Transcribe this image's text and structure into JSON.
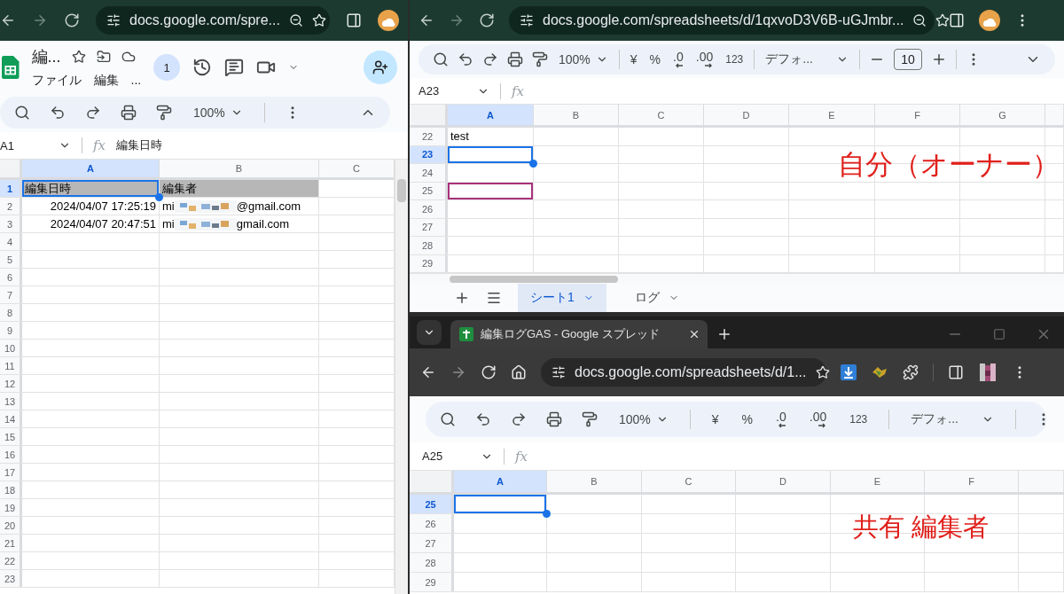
{
  "left_window": {
    "address_bar": {
      "url": "docs.google.com/spre..."
    },
    "document": {
      "title": "編...",
      "menus": [
        "ファイル",
        "編集",
        "..."
      ],
      "viewer_count": "1"
    },
    "toolbar": {
      "zoom": "100%"
    },
    "formula_bar": {
      "name_box": "A1",
      "function_label": "fx",
      "value": "編集日時"
    },
    "grid": {
      "columns": [
        {
          "label": "A",
          "selected": true
        },
        {
          "label": "B",
          "selected": false
        },
        {
          "label": "C",
          "selected": false
        }
      ],
      "rows": [
        {
          "label": "1",
          "selected": true,
          "cells": [
            {
              "kind": "header",
              "text": "編集日時",
              "selected": true,
              "collaborator": false
            },
            {
              "kind": "header",
              "text": "編集者",
              "selected": false,
              "collaborator": false
            }
          ]
        },
        {
          "label": "2",
          "selected": false,
          "cells": [
            {
              "kind": "date",
              "text": "2024/04/07 17:25:19",
              "selected": false,
              "collaborator": false
            },
            {
              "kind": "email",
              "prefix": "mi",
              "suffix": "@gmail.com",
              "selected": false,
              "collaborator": false
            }
          ]
        },
        {
          "label": "3",
          "selected": false,
          "cells": [
            {
              "kind": "date",
              "text": "2024/04/07 20:47:51",
              "selected": false,
              "collaborator": false
            },
            {
              "kind": "email",
              "prefix": "mi",
              "suffix": "gmail.com",
              "selected": false,
              "collaborator": false
            }
          ]
        },
        {
          "label": "4",
          "selected": false
        },
        {
          "label": "5",
          "selected": false
        },
        {
          "label": "6",
          "selected": false
        },
        {
          "label": "7",
          "selected": false
        },
        {
          "label": "8",
          "selected": false
        },
        {
          "label": "9",
          "selected": false
        },
        {
          "label": "10",
          "selected": false
        },
        {
          "label": "11",
          "selected": false
        },
        {
          "label": "12",
          "selected": false
        },
        {
          "label": "13",
          "selected": false
        },
        {
          "label": "14",
          "selected": false
        },
        {
          "label": "15",
          "selected": false
        },
        {
          "label": "16",
          "selected": false
        },
        {
          "label": "17",
          "selected": false
        },
        {
          "label": "18",
          "selected": false
        },
        {
          "label": "19",
          "selected": false
        },
        {
          "label": "20",
          "selected": false
        },
        {
          "label": "21",
          "selected": false
        },
        {
          "label": "22",
          "selected": false
        },
        {
          "label": "23",
          "selected": false
        }
      ]
    }
  },
  "owner_window": {
    "address_bar": {
      "url": "docs.google.com/spreadsheets/d/1qxvoD3V6B-uGJmbr..."
    },
    "toolbar": {
      "zoom": "100%",
      "currency": "¥",
      "percent": "%",
      "decrease_decimal": ".0",
      "increase_decimal": ".00",
      "number_format": "123",
      "font": "デフォ...",
      "font_size": "10"
    },
    "formula_bar": {
      "name_box": "A23",
      "function_label": "fx"
    },
    "grid": {
      "columns": [
        {
          "label": "A",
          "selected": true
        },
        {
          "label": "B",
          "selected": false
        },
        {
          "label": "C",
          "selected": false
        },
        {
          "label": "D",
          "selected": false
        },
        {
          "label": "E",
          "selected": false
        },
        {
          "label": "F",
          "selected": false
        },
        {
          "label": "G",
          "selected": false
        }
      ],
      "rows": [
        {
          "label": "22",
          "selected": false,
          "cells": [
            {
              "text": "test",
              "selected": false,
              "collaborator": false
            }
          ]
        },
        {
          "label": "23",
          "selected": true,
          "cells": [
            {
              "selected": true,
              "collaborator": false
            }
          ]
        },
        {
          "label": "24",
          "selected": false
        },
        {
          "label": "25",
          "selected": false,
          "cells": [
            {
              "selected": false,
              "collaborator": true
            }
          ]
        },
        {
          "label": "26",
          "selected": false
        },
        {
          "label": "27",
          "selected": false
        },
        {
          "label": "28",
          "selected": false
        },
        {
          "label": "29",
          "selected": false
        }
      ]
    },
    "sheet_tabs": [
      {
        "label": "シート1",
        "selected": true
      },
      {
        "label": "ログ",
        "selected": false
      }
    ],
    "annotation": "自分（オーナー）"
  },
  "editor_window": {
    "browser_tab": {
      "title": "編集ログGAS - Google スプレッド"
    },
    "address_bar": {
      "url": "docs.google.com/spreadsheets/d/1..."
    },
    "toolbar": {
      "zoom": "100%",
      "currency": "¥",
      "percent": "%",
      "decrease_decimal": ".0",
      "increase_decimal": ".00",
      "number_format": "123",
      "font": "デフォ..."
    },
    "formula_bar": {
      "name_box": "A25",
      "function_label": "fx"
    },
    "grid": {
      "columns": [
        {
          "label": "A",
          "selected": true
        },
        {
          "label": "B",
          "selected": false
        },
        {
          "label": "C",
          "selected": false
        },
        {
          "label": "D",
          "selected": false
        },
        {
          "label": "E",
          "selected": false
        },
        {
          "label": "F",
          "selected": false
        }
      ],
      "rows": [
        {
          "label": "25",
          "selected": true,
          "cells": [
            {
              "selected": true,
              "collaborator": false
            }
          ]
        },
        {
          "label": "26",
          "selected": false
        },
        {
          "label": "27",
          "selected": false
        },
        {
          "label": "28",
          "selected": false
        },
        {
          "label": "29",
          "selected": false
        }
      ]
    },
    "annotation": "共有 編集者"
  }
}
